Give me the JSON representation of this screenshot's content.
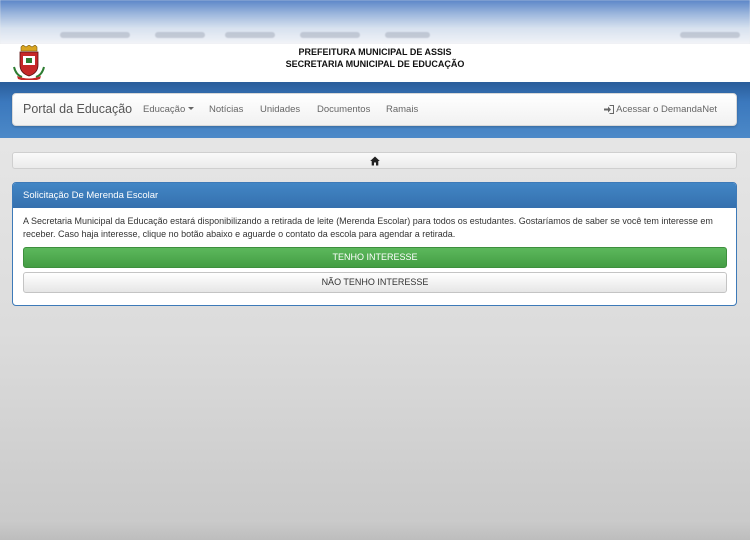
{
  "header": {
    "line1": "PREFEITURA MUNICIPAL DE ASSIS",
    "line2": "SECRETARIA MUNICIPAL DE EDUCAÇÃO"
  },
  "navbar": {
    "brand": "Portal da Educação",
    "items": [
      {
        "label": "Educação",
        "dropdown": true
      },
      {
        "label": "Notícias"
      },
      {
        "label": "Unidades"
      },
      {
        "label": "Documentos"
      },
      {
        "label": "Ramais"
      }
    ],
    "login_label": "Acessar o DemandaNet",
    "login_icon": "sign-in-icon"
  },
  "breadcrumb": {
    "icon": "home-icon"
  },
  "panel": {
    "title": "Solicitação De Merenda Escolar",
    "text": "A Secretaria Municipal da Educação estará disponibilizando a retirada de leite (Merenda Escolar) para todos os estudantes. Gostaríamos de saber se você tem interesse em receber. Caso haja interesse, clique no botão abaixo e aguarde o contato da escola para agendar a retirada.",
    "yes_label": "TENHO INTERESSE",
    "no_label": "NÃO TENHO INTERESSE"
  },
  "colors": {
    "band": "#3b78bd",
    "panel_heading": "#3d7ab8",
    "success": "#5cb85c"
  }
}
